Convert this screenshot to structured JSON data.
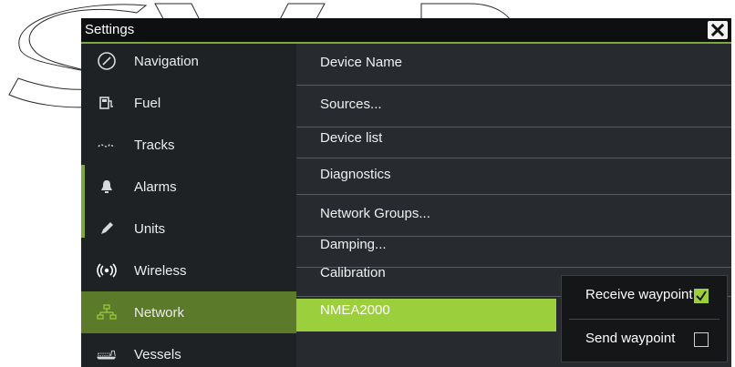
{
  "window": {
    "title": "Settings",
    "close_icon": "close-icon"
  },
  "sidebar": {
    "items": [
      {
        "label": "Navigation",
        "icon": "compass-icon"
      },
      {
        "label": "Fuel",
        "icon": "fuel-pump-icon"
      },
      {
        "label": "Tracks",
        "icon": "tracks-icon"
      },
      {
        "label": "Alarms",
        "icon": "bell-icon"
      },
      {
        "label": "Units",
        "icon": "pencil-icon"
      },
      {
        "label": "Wireless",
        "icon": "wireless-icon"
      },
      {
        "label": "Network",
        "icon": "network-icon",
        "active": true
      },
      {
        "label": "Vessels",
        "icon": "vessels-icon"
      }
    ]
  },
  "main": {
    "rows": [
      {
        "label": "Device Name"
      },
      {
        "label": "Sources..."
      },
      {
        "label": "Device list"
      },
      {
        "label": "Diagnostics"
      },
      {
        "label": "Network Groups..."
      },
      {
        "label": "Damping..."
      },
      {
        "label": "Calibration"
      },
      {
        "label": "NMEA2000"
      }
    ]
  },
  "popup": {
    "items": [
      {
        "label": "Receive waypoint",
        "checked": true
      },
      {
        "label": "Send waypoint",
        "checked": false
      }
    ]
  },
  "colors": {
    "accent": "#9ccf3c",
    "active_side": "#5b7a2a",
    "panel_bg": "#272b2f",
    "title_bg": "#0e0f10"
  }
}
